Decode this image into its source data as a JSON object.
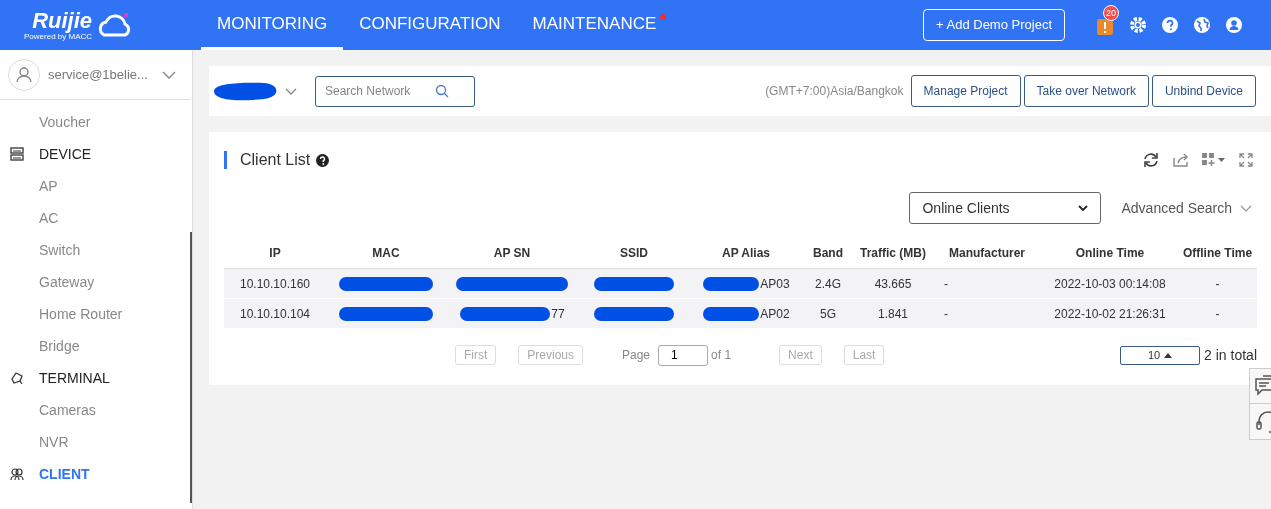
{
  "header": {
    "logo": {
      "name": "Ruijie",
      "tagline": "Powered by MACC"
    },
    "nav": [
      {
        "label": "MONITORING",
        "selected": true,
        "alert": false
      },
      {
        "label": "CONFIGURATION",
        "selected": false,
        "alert": false
      },
      {
        "label": "MAINTENANCE",
        "selected": false,
        "alert": true
      }
    ],
    "add_button": "+ Add Demo Project",
    "notification_count": "20"
  },
  "sidebar": {
    "account": "service@1belie...",
    "items": [
      {
        "kind": "item",
        "label": "Voucher",
        "selected": false
      },
      {
        "kind": "section",
        "label": "DEVICE",
        "selected": false
      },
      {
        "kind": "item",
        "label": "AP",
        "selected": false
      },
      {
        "kind": "item",
        "label": "AC",
        "selected": false
      },
      {
        "kind": "item",
        "label": "Switch",
        "selected": false
      },
      {
        "kind": "item",
        "label": "Gateway",
        "selected": false
      },
      {
        "kind": "item",
        "label": "Home Router",
        "selected": false
      },
      {
        "kind": "item",
        "label": "Bridge",
        "selected": false
      },
      {
        "kind": "section",
        "label": "TERMINAL",
        "selected": false
      },
      {
        "kind": "item",
        "label": "Cameras",
        "selected": false
      },
      {
        "kind": "item",
        "label": "NVR",
        "selected": false
      },
      {
        "kind": "section",
        "label": "CLIENT",
        "selected": true
      }
    ]
  },
  "toolbar": {
    "search": {
      "placeholder": "Search Network"
    },
    "timezone": "(GMT+7:00)Asia/Bangkok",
    "buttons": [
      "Manage Project",
      "Take over Network",
      "Unbind Device"
    ]
  },
  "client_list": {
    "title": "Client List",
    "filter": "Online Clients",
    "advanced_search": "Advanced Search",
    "columns": [
      "IP",
      "MAC",
      "AP SN",
      "SSID",
      "AP Alias",
      "Band",
      "Traffic (MB)",
      "Manufacturer",
      "Online Time",
      "Offline Time"
    ],
    "rows": [
      [
        {
          "text": "10.10.10.160",
          "redacted": false
        },
        {
          "redacted": true
        },
        {
          "redacted": true
        },
        {
          "redacted": true
        },
        {
          "text": "AP03",
          "redacted": true
        },
        {
          "text": "2.4G",
          "redacted": false
        },
        {
          "text": "43.665",
          "redacted": false
        },
        {
          "text": "-",
          "redacted": false
        },
        {
          "text": "2022-10-03 00:14:08",
          "redacted": false
        },
        {
          "text": "-",
          "redacted": false
        }
      ],
      [
        {
          "text": "10.10.10.104",
          "redacted": false
        },
        {
          "redacted": true
        },
        {
          "text": "77",
          "redacted": true
        },
        {
          "redacted": true
        },
        {
          "text": "AP02",
          "redacted": true
        },
        {
          "text": "5G",
          "redacted": false
        },
        {
          "text": "1.841",
          "redacted": false
        },
        {
          "text": "-",
          "redacted": false
        },
        {
          "text": "2022-10-02 21:26:31",
          "redacted": false
        },
        {
          "text": "-",
          "redacted": false
        }
      ]
    ],
    "pagination": {
      "first": {
        "label": "First",
        "disabled": true
      },
      "previous": {
        "label": "Previous",
        "disabled": true
      },
      "page_label": "Page",
      "page": "1",
      "of": "of 1",
      "next": {
        "label": "Next",
        "disabled": true
      },
      "last": {
        "label": "Last",
        "disabled": true
      },
      "page_size": "10",
      "total": "2 in total"
    }
  }
}
